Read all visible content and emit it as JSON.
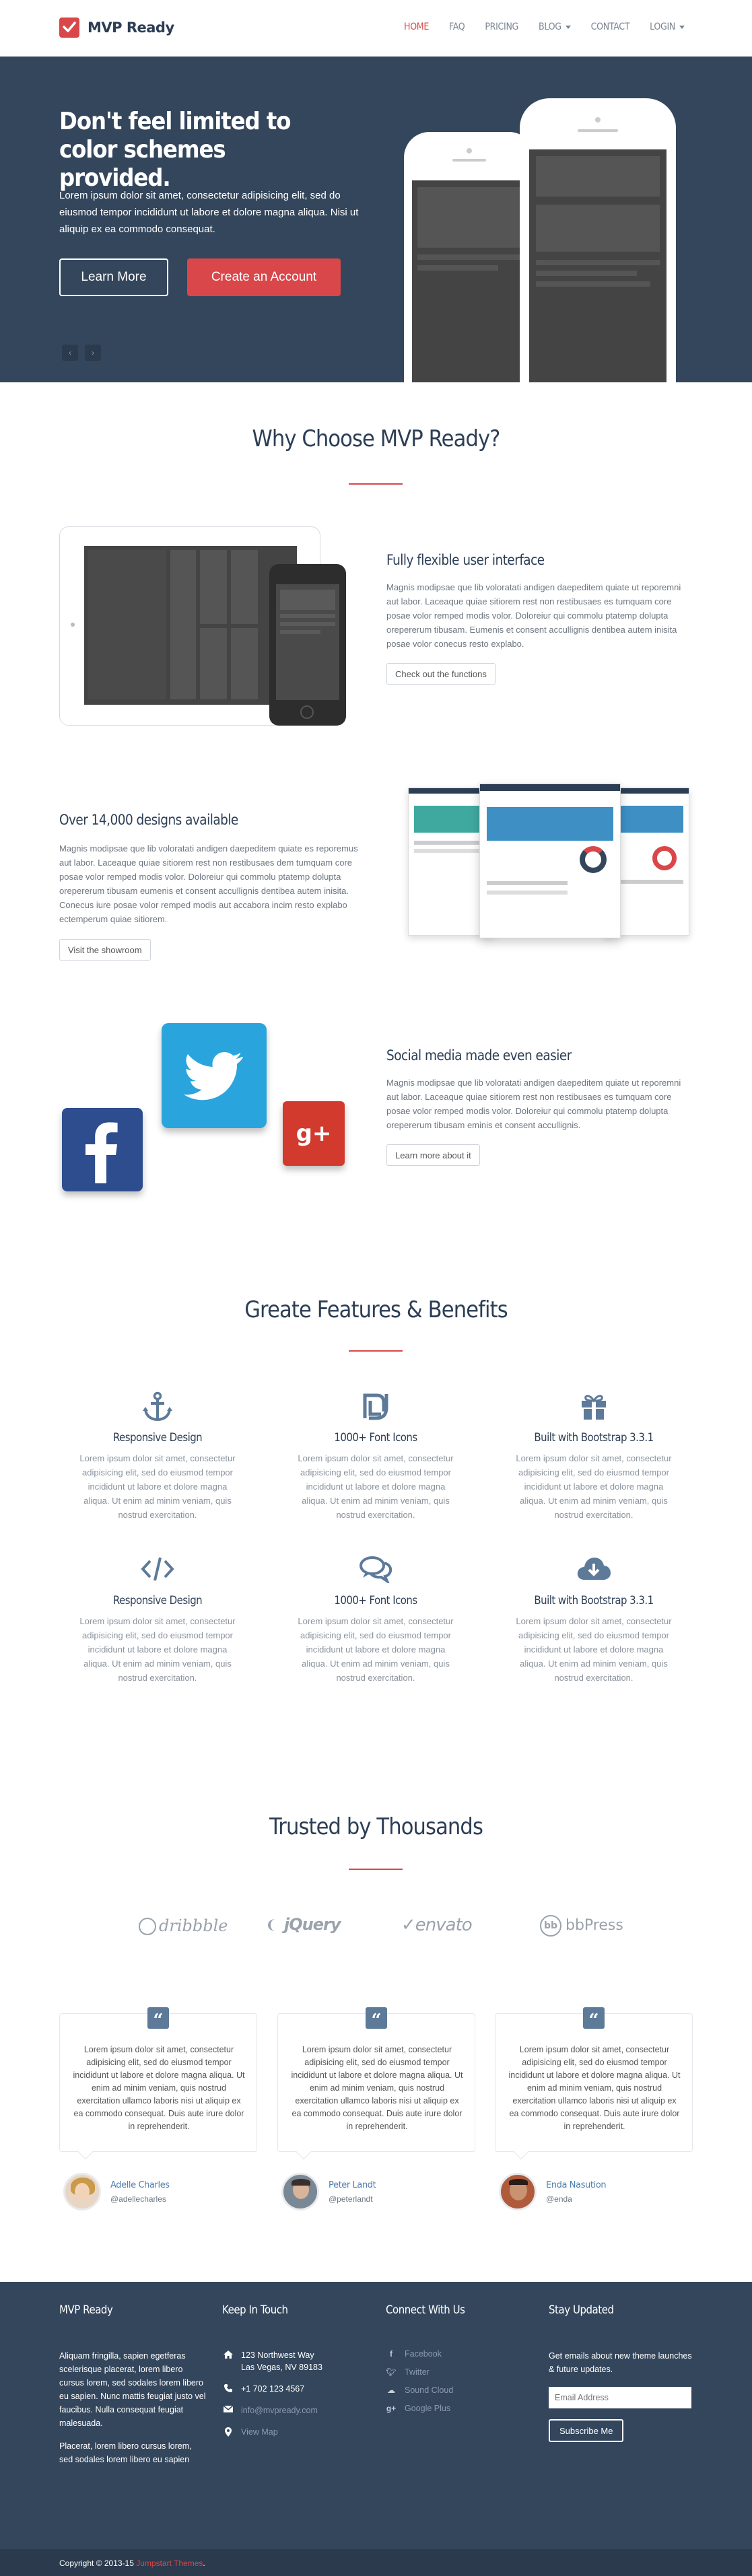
{
  "header": {
    "brand": "MVP Ready",
    "nav": [
      {
        "label": "HOME",
        "active": true
      },
      {
        "label": "FAQ"
      },
      {
        "label": "PRICING"
      },
      {
        "label": "BLOG",
        "dropdown": true
      },
      {
        "label": "CONTACT"
      },
      {
        "label": "LOGIN",
        "dropdown": true
      }
    ]
  },
  "hero": {
    "title": "Don't feel limited to color schemes provided.",
    "text": "Lorem ipsum dolor sit amet, consectetur adipisicing elit, sed do eiusmod tempor incididunt ut labore et dolore magna aliqua. Nisi ut aliquip ex ea commodo consequat.",
    "btn_learn": "Learn More",
    "btn_create": "Create an Account",
    "prev": "‹",
    "next": "›"
  },
  "why": {
    "title": "Why Choose MVP Ready?",
    "items": [
      {
        "title": "Fully flexible user interface",
        "text": "Magnis modipsae que lib voloratati andigen daepeditem quiate ut reporemni aut labor. Laceaque quiae sitiorem rest non restibusaes es tumquam core posae volor remped modis volor. Doloreiur qui commolu ptatemp dolupta orepererum tibusam. Eumenis et consent accullignis dentibea autem inisita posae volor conecus resto explabo.",
        "button": "Check out the functions"
      },
      {
        "title": "Over 14,000 designs available",
        "text": "Magnis modipsae que lib voloratati andigen daepeditem quiate es reporemus aut labor. Laceaque quiae sitiorem rest non restibusaes dem tumquam core posae volor remped modis volor. Doloreiur qui commolu ptatemp dolupta orepererum tibusam eumenis et consent accullignis dentibea autem inisita. Conecus iure posae volor remped modis aut accabora incim resto explabo ectemperum quiae sitiorem.",
        "button": "Visit the showroom"
      },
      {
        "title": "Social media made even easier",
        "text": "Magnis modipsae que lib voloratati andigen daepeditem quiate ut reporemni aut labor. Laceaque quiae sitiorem rest non restibusaes es tumquam core posae volor remped modis volor. Doloreiur qui commolu ptatemp dolupta orepererum tibusam eminis et consent accullignis.",
        "button": "Learn more about it"
      }
    ]
  },
  "benefits": {
    "title": "Greate Features & Benefits",
    "items": [
      {
        "icon": "anchor-icon",
        "title": "Responsive Design",
        "text": "Lorem ipsum dolor sit amet, consectetur adipisicing elit, sed do eiusmod tempor incididunt ut labore et dolore magna aliqua. Ut enim ad minim veniam, quis nostrud exercitation."
      },
      {
        "icon": "shekel-icon",
        "title": "1000+ Font Icons",
        "text": "Lorem ipsum dolor sit amet, consectetur adipisicing elit, sed do eiusmod tempor incididunt ut labore et dolore magna aliqua. Ut enim ad minim veniam, quis nostrud exercitation."
      },
      {
        "icon": "gift-icon",
        "title": "Built with Bootstrap 3.3.1",
        "text": "Lorem ipsum dolor sit amet, consectetur adipisicing elit, sed do eiusmod tempor incididunt ut labore et dolore magna aliqua. Ut enim ad minim veniam, quis nostrud exercitation."
      },
      {
        "icon": "code-icon",
        "title": "Responsive Design",
        "text": "Lorem ipsum dolor sit amet, consectetur adipisicing elit, sed do eiusmod tempor incididunt ut labore et dolore magna aliqua. Ut enim ad minim veniam, quis nostrud exercitation."
      },
      {
        "icon": "comments-icon",
        "title": "1000+ Font Icons",
        "text": "Lorem ipsum dolor sit amet, consectetur adipisicing elit, sed do eiusmod tempor incididunt ut labore et dolore magna aliqua. Ut enim ad minim veniam, quis nostrud exercitation."
      },
      {
        "icon": "cloud-download-icon",
        "title": "Built with Bootstrap 3.3.1",
        "text": "Lorem ipsum dolor sit amet, consectetur adipisicing elit, sed do eiusmod tempor incididunt ut labore et dolore magna aliqua. Ut enim ad minim veniam, quis nostrud exercitation."
      }
    ]
  },
  "trusted": {
    "title": "Trusted by Thousands",
    "logos": [
      "dribbble",
      "jQuery",
      "envato",
      "bbPress"
    ],
    "testimonials": [
      {
        "text": "Lorem ipsum dolor sit amet, consectetur adipisicing elit, sed do eiusmod tempor incididunt ut labore et dolore magna aliqua. Ut enim ad minim veniam, quis nostrud exercitation ullamco laboris nisi ut aliquip ex ea commodo consequat. Duis aute irure dolor in reprehenderit.",
        "name": "Adelle Charles",
        "handle": "@adellecharles"
      },
      {
        "text": "Lorem ipsum dolor sit amet, consectetur adipisicing elit, sed do eiusmod tempor incididunt ut labore et dolore magna aliqua. Ut enim ad minim veniam, quis nostrud exercitation ullamco laboris nisi ut aliquip ex ea commodo consequat. Duis aute irure dolor in reprehenderit.",
        "name": "Peter Landt",
        "handle": "@peterlandt"
      },
      {
        "text": "Lorem ipsum dolor sit amet, consectetur adipisicing elit, sed do eiusmod tempor incididunt ut labore et dolore magna aliqua. Ut enim ad minim veniam, quis nostrud exercitation ullamco laboris nisi ut aliquip ex ea commodo consequat. Duis aute irure dolor in reprehenderit.",
        "name": "Enda Nasution",
        "handle": "@enda"
      }
    ]
  },
  "footer": {
    "about_title": "MVP Ready",
    "about_text_1": "Aliquam fringilla, sapien egetferas scelerisque placerat, lorem libero cursus lorem, sed sodales lorem libero eu sapien. Nunc mattis feugiat justo vel faucibus. Nulla consequat feugiat malesuada.",
    "about_text_2": "Placerat, lorem libero cursus lorem, sed sodales lorem libero eu sapien",
    "contact_title": "Keep In Touch",
    "address_1": "123 Northwest Way",
    "address_2": "Las Vegas, NV 89183",
    "phone": "+1 702 123 4567",
    "email": "info@mvpready.com",
    "map": "View Map",
    "social_title": "Connect With Us",
    "social": [
      "Facebook",
      "Twitter",
      "Sound Cloud",
      "Google Plus"
    ],
    "newsletter_title": "Stay Updated",
    "newsletter_text": "Get emails about new theme launches & future updates.",
    "email_placeholder": "Email Address",
    "subscribe": "Subscribe Me",
    "copyright": "Copyright © 2013-15 ",
    "copyright_link": "Jumpstart Themes",
    "copyright_end": "."
  },
  "colors": {
    "accent": "#d9474a",
    "navy": "#34465c",
    "heading": "#2c3e55",
    "icon": "#5d7a99"
  }
}
